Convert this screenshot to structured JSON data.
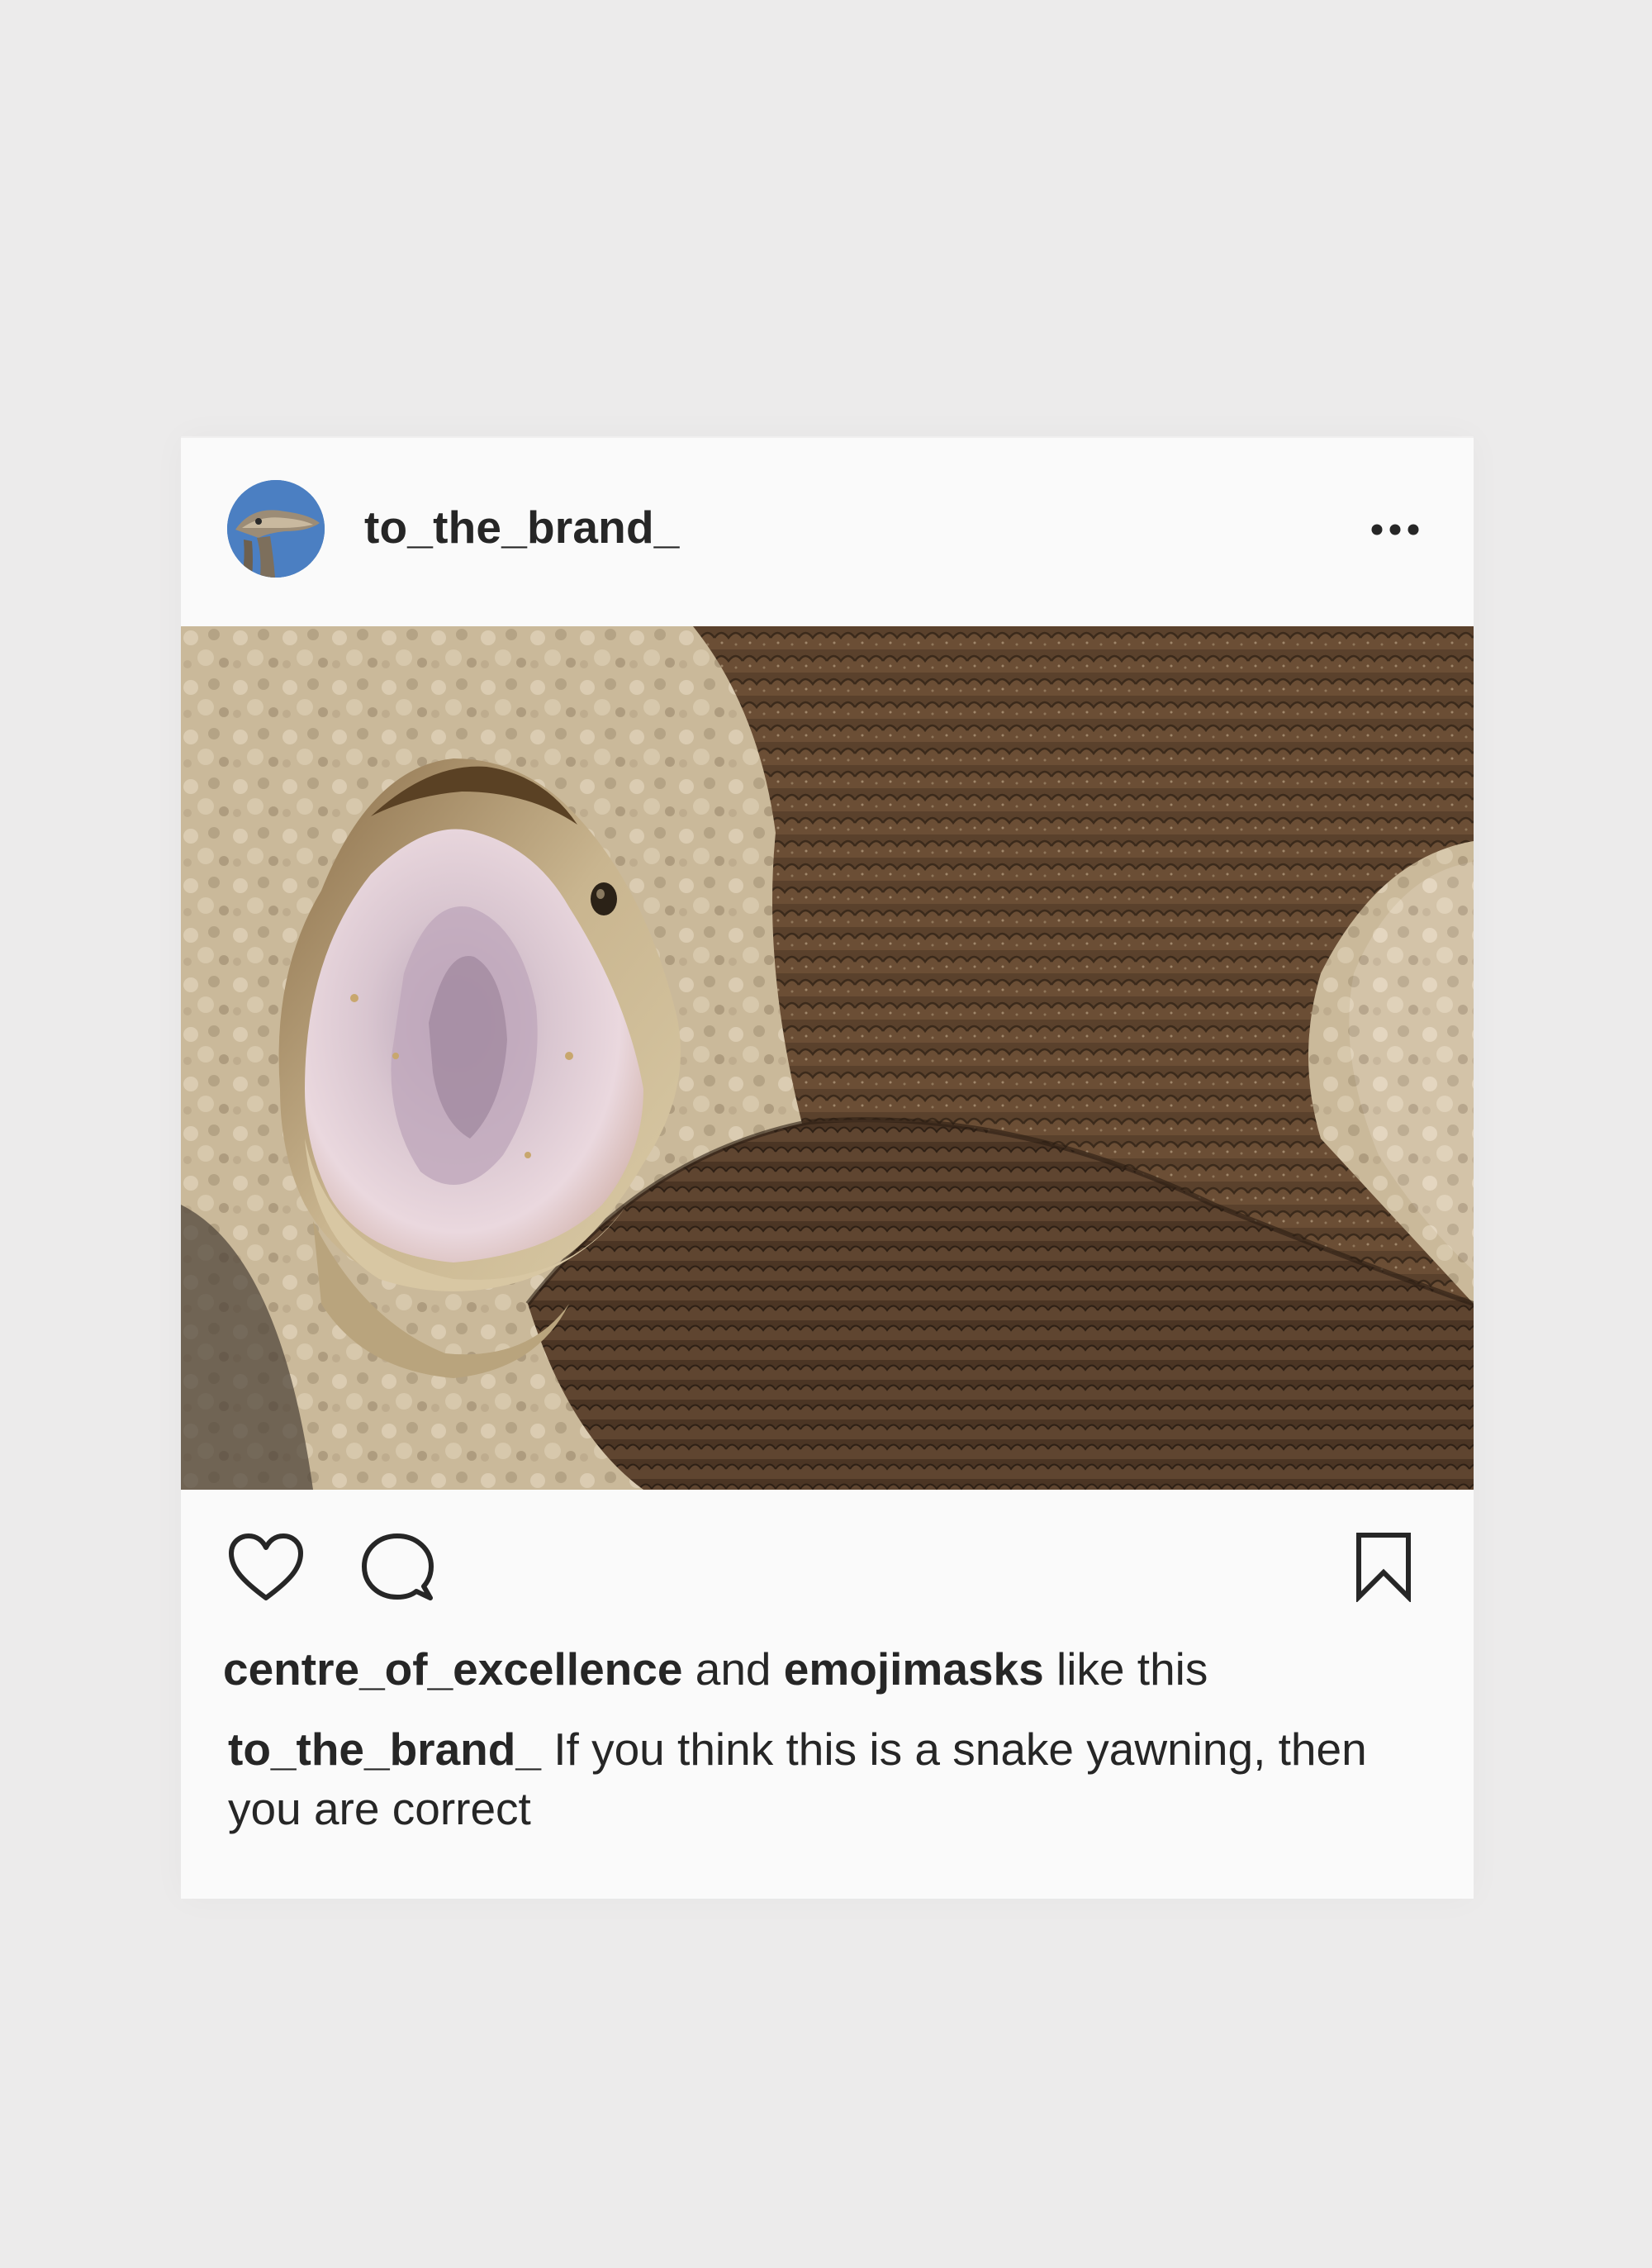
{
  "post": {
    "username": "to_the_brand_",
    "avatar_icon": "snake-head-avatar",
    "more_icon": "more-options-icon",
    "photo_alt": "",
    "actions": {
      "like_icon": "heart-icon",
      "comment_icon": "comment-icon",
      "save_icon": "bookmark-icon"
    },
    "likes": {
      "user1": "centre_of_excellence",
      "connector": " and ",
      "user2": "emojimasks",
      "suffix": " like this"
    },
    "caption": {
      "username": "to_the_brand_",
      "text": " If you think this is a snake yawning, then you are correct"
    }
  },
  "colors": {
    "background": "#ecebeb",
    "card": "#fafafa",
    "text": "#262626"
  }
}
